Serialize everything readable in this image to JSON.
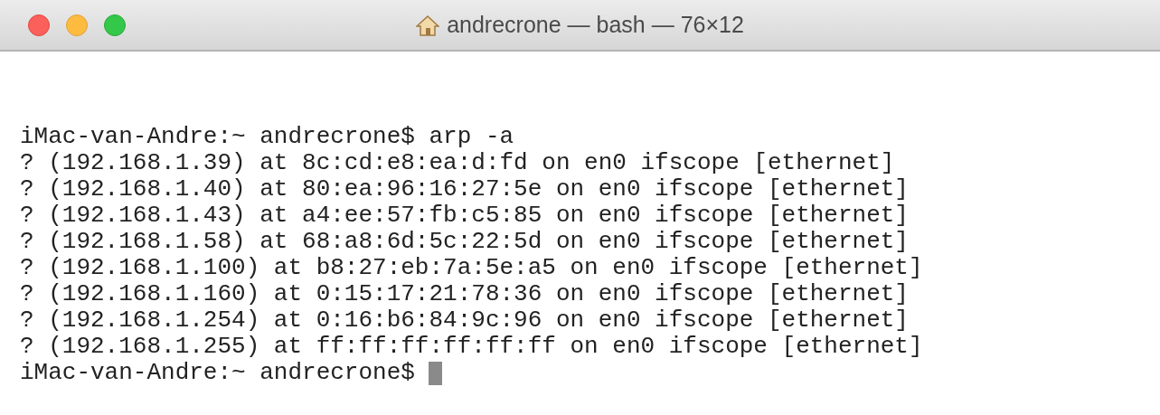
{
  "window": {
    "title": "andrecrone — bash — 76×12"
  },
  "terminal": {
    "lines": [
      {
        "kind": "command",
        "text": "iMac-van-Andre:~ andrecrone$ arp -a"
      },
      {
        "kind": "output",
        "text": "? (192.168.1.39) at 8c:cd:e8:ea:d:fd on en0 ifscope [ethernet]"
      },
      {
        "kind": "output",
        "text": "? (192.168.1.40) at 80:ea:96:16:27:5e on en0 ifscope [ethernet]"
      },
      {
        "kind": "output",
        "text": "? (192.168.1.43) at a4:ee:57:fb:c5:85 on en0 ifscope [ethernet]"
      },
      {
        "kind": "output",
        "text": "? (192.168.1.58) at 68:a8:6d:5c:22:5d on en0 ifscope [ethernet]"
      },
      {
        "kind": "output",
        "text": "? (192.168.1.100) at b8:27:eb:7a:5e:a5 on en0 ifscope [ethernet]"
      },
      {
        "kind": "output",
        "text": "? (192.168.1.160) at 0:15:17:21:78:36 on en0 ifscope [ethernet]"
      },
      {
        "kind": "output",
        "text": "? (192.168.1.254) at 0:16:b6:84:9c:96 on en0 ifscope [ethernet]"
      },
      {
        "kind": "output",
        "text": "? (192.168.1.255) at ff:ff:ff:ff:ff:ff on en0 ifscope [ethernet]"
      },
      {
        "kind": "prompt",
        "text": "iMac-van-Andre:~ andrecrone$"
      }
    ]
  }
}
